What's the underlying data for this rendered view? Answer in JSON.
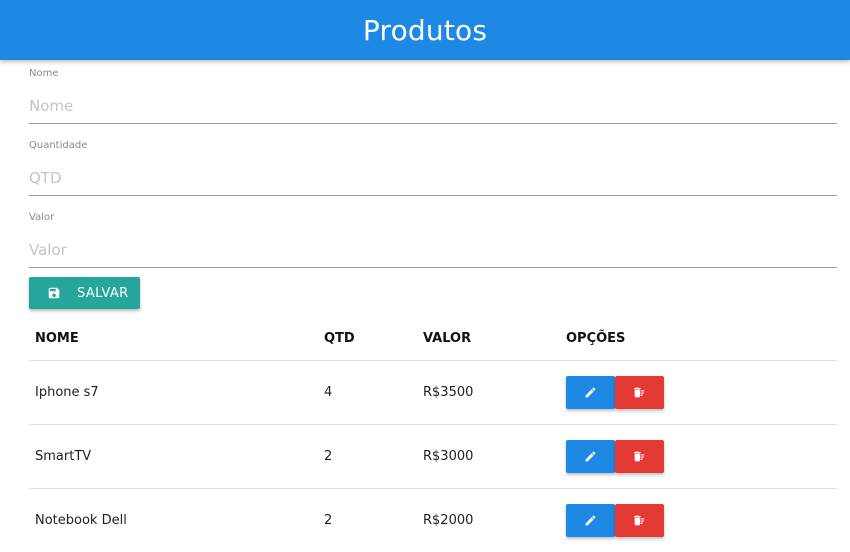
{
  "header": {
    "title": "Produtos"
  },
  "colors": {
    "primary": "#1e88e5",
    "save": "#26a69a",
    "edit": "#1e88e5",
    "delete": "#e53935"
  },
  "form": {
    "nome": {
      "label": "Nome",
      "placeholder": "Nome",
      "value": ""
    },
    "qtd": {
      "label": "Quantidade",
      "placeholder": "QTD",
      "value": ""
    },
    "valor": {
      "label": "Valor",
      "placeholder": "Valor",
      "value": ""
    },
    "save_label": "SALVAR",
    "save_icon": "floppy-disk-icon"
  },
  "table": {
    "headers": [
      "NOME",
      "QTD",
      "VALOR",
      "OPÇÕES"
    ],
    "rows": [
      {
        "nome": "Iphone s7",
        "qtd": "4",
        "valor": "R$3500"
      },
      {
        "nome": "SmartTV",
        "qtd": "2",
        "valor": "R$3000"
      },
      {
        "nome": "Notebook Dell",
        "qtd": "2",
        "valor": "R$2000"
      }
    ],
    "edit_icon": "pencil-icon",
    "delete_icon": "trash-icon"
  }
}
